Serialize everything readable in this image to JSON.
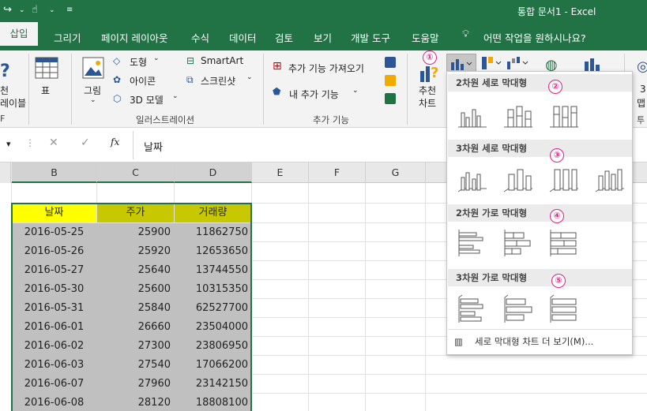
{
  "titlebar": {
    "doc_title": "통합 문서1  -  Excel"
  },
  "tabs": [
    "삽입",
    "그리기",
    "페이지 레이아웃",
    "수식",
    "데이터",
    "검토",
    "보기",
    "개발 도구",
    "도움말",
    "어떤 작업을 원하시나요?"
  ],
  "ribbon": {
    "partial_left_1": "천",
    "partial_left_2": "레이블",
    "partial_left_3": "F",
    "table": "표",
    "picture": "그림",
    "shapes": "도형",
    "icons": "아이콘",
    "models3d": "3D 모델",
    "smartart": "SmartArt",
    "screenshot": "스크린샷",
    "group_illustration": "일러스트레이션",
    "get_addins": "추가 기능 가져오기",
    "my_addins": "내 추가 기능",
    "group_addins": "추가 기능",
    "recommended_1": "추천",
    "recommended_2": "차트",
    "partial_right_1": "3",
    "partial_right_2": "맵",
    "partial_right_3": "투"
  },
  "formula": {
    "namebox_arrow": "▾",
    "content": "날짜"
  },
  "columns": [
    "B",
    "C",
    "D",
    "E",
    "F",
    "G"
  ],
  "table": {
    "headers": [
      "날짜",
      "주가",
      "거래량"
    ],
    "rows": [
      [
        "2016-05-25",
        "25900",
        "11862750"
      ],
      [
        "2016-05-26",
        "25920",
        "12653650"
      ],
      [
        "2016-05-27",
        "25640",
        "13744550"
      ],
      [
        "2016-05-30",
        "25600",
        "10315350"
      ],
      [
        "2016-05-31",
        "25840",
        "62527700"
      ],
      [
        "2016-06-01",
        "26660",
        "23504000"
      ],
      [
        "2016-06-02",
        "27300",
        "23806950"
      ],
      [
        "2016-06-03",
        "27540",
        "17066200"
      ],
      [
        "2016-06-07",
        "27960",
        "23142150"
      ],
      [
        "2016-06-08",
        "28120",
        "18808100"
      ]
    ]
  },
  "dropdown": {
    "sections": [
      {
        "label": "2차원 세로 막대형",
        "badge": "②"
      },
      {
        "label": "3차원 세로 막대형",
        "badge": "③"
      },
      {
        "label": "2차원 가로 막대형",
        "badge": "④"
      },
      {
        "label": "3차원 가로 막대형",
        "badge": "⑤"
      }
    ],
    "more": "세로 막대형 차트 더 보기(M)..."
  },
  "badge1": "①",
  "colors": {
    "excel_green": "#217346",
    "header_yellow": "#ffff00",
    "header_olive": "#c8c800",
    "badge_pink": "#e0208a"
  }
}
